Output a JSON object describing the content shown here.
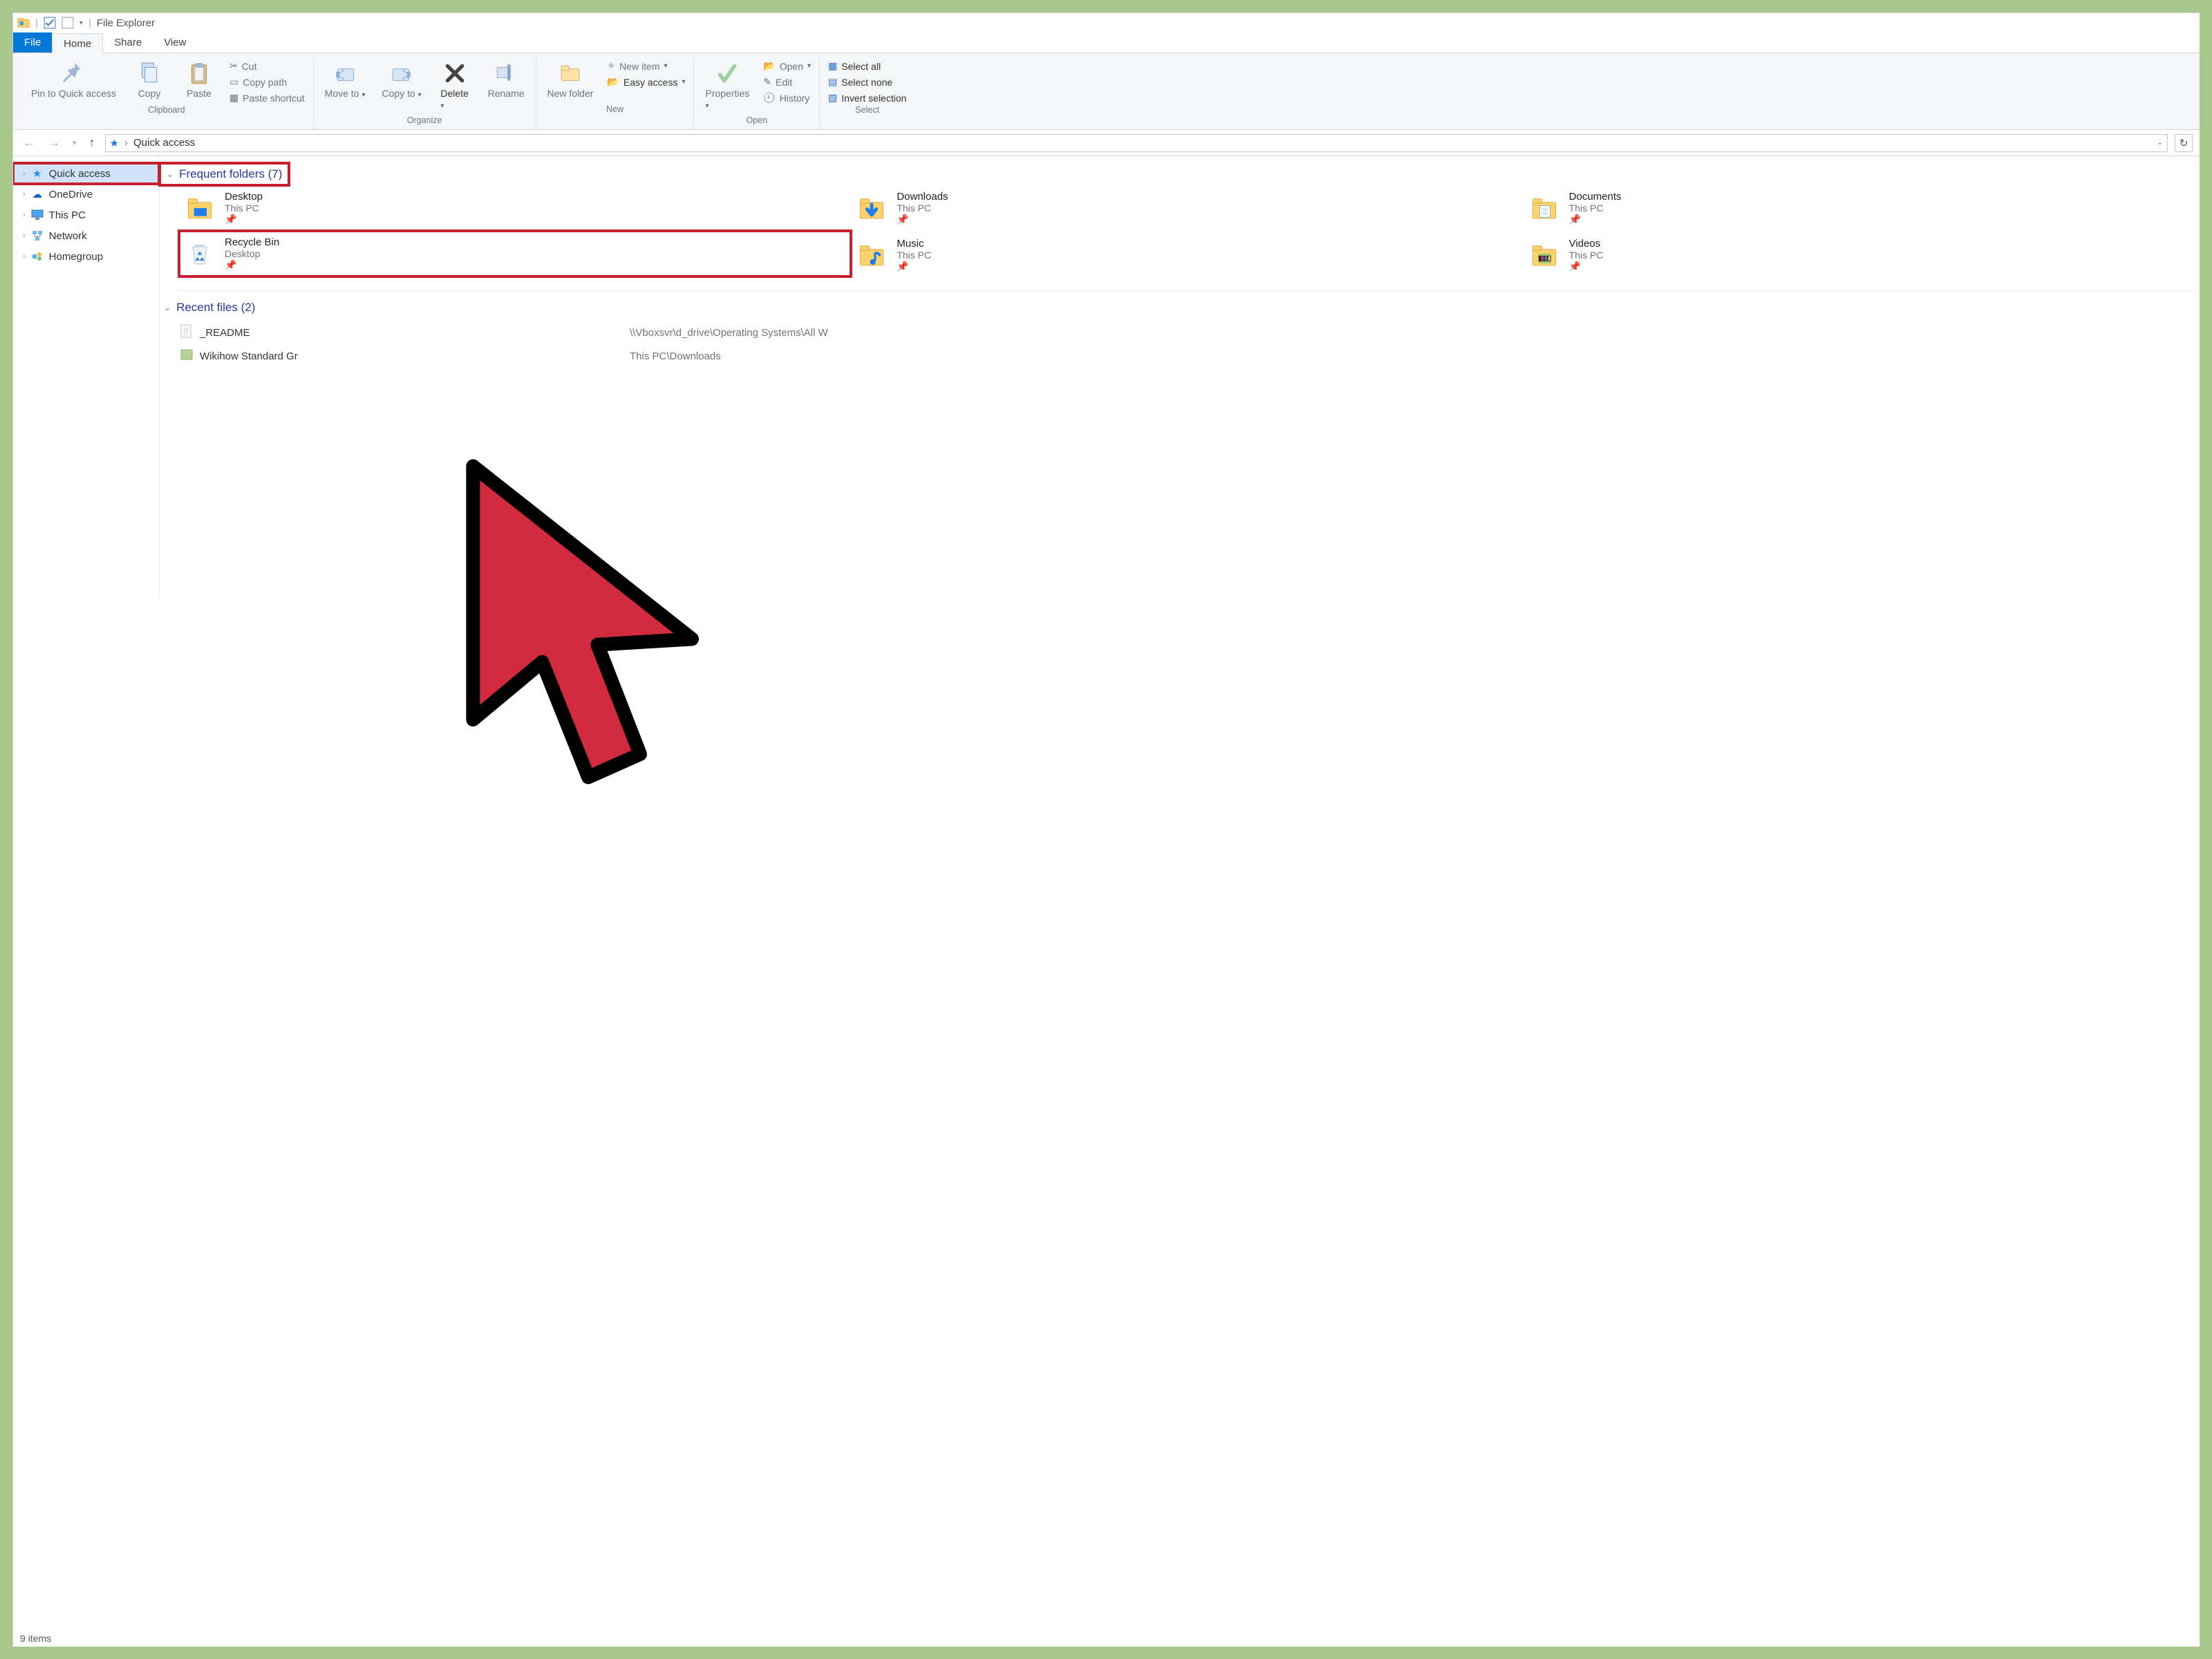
{
  "title": "File Explorer",
  "tabs": {
    "file": "File",
    "home": "Home",
    "share": "Share",
    "view": "View"
  },
  "ribbon": {
    "clipboard": {
      "label": "Clipboard",
      "pin": "Pin to Quick access",
      "copy": "Copy",
      "paste": "Paste",
      "cut": "Cut",
      "copy_path": "Copy path",
      "paste_shortcut": "Paste shortcut"
    },
    "organize": {
      "label": "Organize",
      "move_to": "Move to",
      "copy_to": "Copy to",
      "delete": "Delete",
      "rename": "Rename"
    },
    "new": {
      "label": "New",
      "new_folder": "New folder",
      "new_item": "New item",
      "easy_access": "Easy access"
    },
    "open": {
      "label": "Open",
      "properties": "Properties",
      "open": "Open",
      "edit": "Edit",
      "history": "History"
    },
    "select": {
      "label": "Select",
      "select_all": "Select all",
      "select_none": "Select none",
      "invert": "Invert selection"
    }
  },
  "breadcrumb": {
    "root": "Quick access"
  },
  "sidebar": {
    "items": [
      {
        "label": "Quick access"
      },
      {
        "label": "OneDrive"
      },
      {
        "label": "This PC"
      },
      {
        "label": "Network"
      },
      {
        "label": "Homegroup"
      }
    ]
  },
  "sections": {
    "frequent": {
      "title": "Frequent folders (7)"
    },
    "recent": {
      "title": "Recent files (2)"
    }
  },
  "folders": [
    {
      "name": "Desktop",
      "location": "This PC",
      "icon": "desktop"
    },
    {
      "name": "Downloads",
      "location": "This PC",
      "icon": "downloads"
    },
    {
      "name": "Documents",
      "location": "This PC",
      "icon": "documents"
    },
    {
      "name": "Recycle Bin",
      "location": "Desktop",
      "icon": "recycle",
      "highlighted": true
    },
    {
      "name": "Music",
      "location": "This PC",
      "icon": "music"
    },
    {
      "name": "Videos",
      "location": "This PC",
      "icon": "videos"
    }
  ],
  "recent_files": [
    {
      "name": "_README",
      "icon": "text",
      "path": "\\\\Vboxsvr\\d_drive\\Operating Systems\\All W"
    },
    {
      "name": "Wikihow Standard Gr",
      "icon": "image",
      "path": "This PC\\Downloads"
    }
  ],
  "status": "9 items"
}
